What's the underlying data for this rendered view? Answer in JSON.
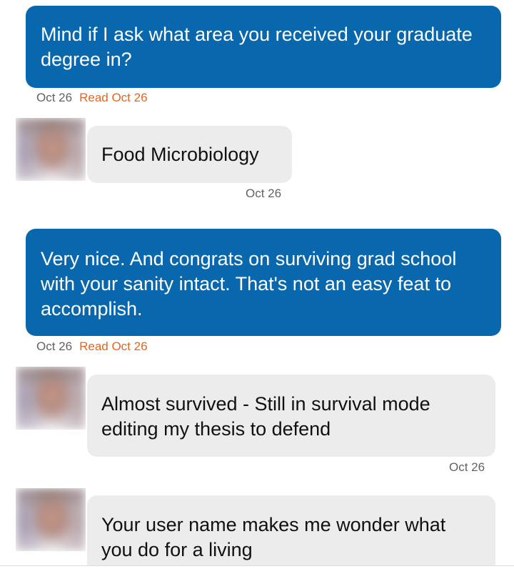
{
  "messages": [
    {
      "direction": "sent",
      "text": "Mind if I ask what area you received your graduate degree in?",
      "date": "Oct 26",
      "read": "Read Oct 26"
    },
    {
      "direction": "received",
      "text": "Food Microbiology",
      "date": "Oct 26"
    },
    {
      "direction": "sent",
      "text": "Very nice. And congrats on surviving grad school with your sanity intact. That's not an easy feat to accomplish.",
      "date": "Oct 26",
      "read": "Read Oct 26"
    },
    {
      "direction": "received",
      "text": "Almost survived - Still in survival mode editing my thesis to defend",
      "date": "Oct 26"
    },
    {
      "direction": "received",
      "text": "Your user name makes me wonder what you do for a living"
    }
  ],
  "colors": {
    "sent_bubble": "#0867ad",
    "received_bubble": "#ececec",
    "read_receipt": "#e8651c",
    "timestamp": "#5f6368"
  }
}
